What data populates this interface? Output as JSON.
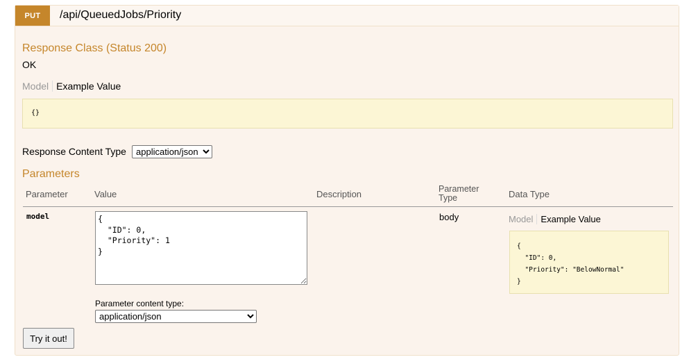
{
  "operation": {
    "method": "PUT",
    "path": "/api/QueuedJobs/Priority"
  },
  "response": {
    "class_title": "Response Class (Status 200)",
    "class_value": "OK",
    "tab_model": "Model",
    "tab_example": "Example Value",
    "example_code": "{}"
  },
  "content_type": {
    "label": "Response Content Type",
    "selected": "application/json"
  },
  "parameters": {
    "title": "Parameters",
    "headers": {
      "parameter": "Parameter",
      "value": "Value",
      "description": "Description",
      "param_type_line1": "Parameter",
      "param_type_line2": "Type",
      "data_type": "Data Type"
    },
    "row": {
      "name": "model",
      "value": "{\n  \"ID\": 0,\n  \"Priority\": 1\n}",
      "description": "",
      "param_type": "body",
      "dt_tab_model": "Model",
      "dt_tab_example": "Example Value",
      "dt_example_code": "{\n  \"ID\": 0,\n  \"Priority\": \"BelowNormal\"\n}",
      "content_type_label": "Parameter content type:",
      "content_type_selected": "application/json"
    }
  },
  "actions": {
    "try_label": "Try it out!"
  }
}
